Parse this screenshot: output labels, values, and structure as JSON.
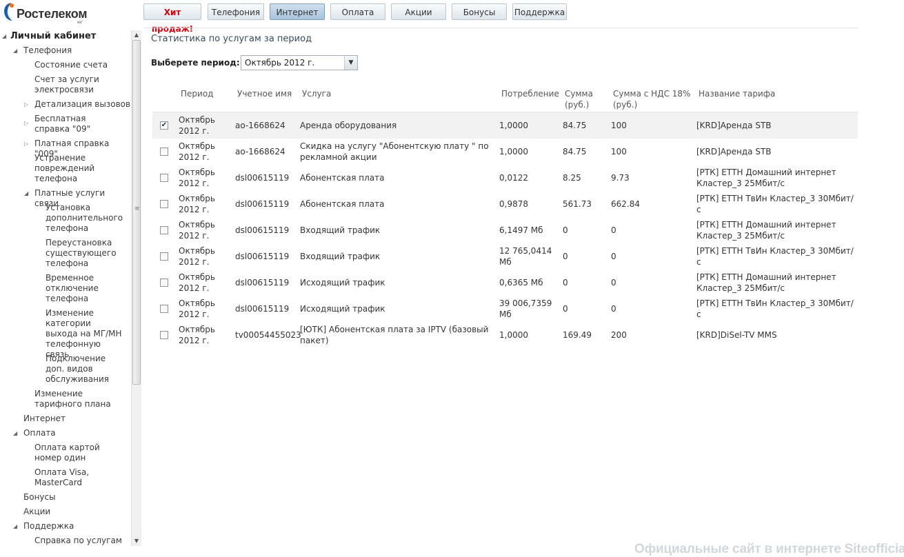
{
  "brand": {
    "name": "Ростелеком",
    "region": "юг"
  },
  "topnav": [
    {
      "label": "Хит продаж!"
    },
    {
      "label": "Телефония"
    },
    {
      "label": "Интернет"
    },
    {
      "label": "Оплата"
    },
    {
      "label": "Акции"
    },
    {
      "label": "Бонусы"
    },
    {
      "label": "Поддержка"
    }
  ],
  "sidebar": {
    "root": "Личный кабинет",
    "items": [
      {
        "label": "Телефония"
      },
      {
        "label": "Состояние счета"
      },
      {
        "label": "Счет за услуги электросвязи"
      },
      {
        "label": "Детализация вызовов"
      },
      {
        "label": "Бесплатная справка \"09\""
      },
      {
        "label": "Платная справка \"009\""
      },
      {
        "label": "Устранение повреждений телефона"
      },
      {
        "label": "Платные услуги связи"
      },
      {
        "label": "Установка дополнительного телефона"
      },
      {
        "label": "Переустановка существующего телефона"
      },
      {
        "label": "Временное отключение телефона"
      },
      {
        "label": "Изменение категории выхода на МГ/МН телефонную связь"
      },
      {
        "label": "Подключение доп. видов обслуживания"
      },
      {
        "label": "Изменение тарифного плана"
      },
      {
        "label": "Интернет"
      },
      {
        "label": "Оплата"
      },
      {
        "label": "Оплата картой номер один"
      },
      {
        "label": "Оплата Visa, MasterCard"
      },
      {
        "label": "Бонусы"
      },
      {
        "label": "Акции"
      },
      {
        "label": "Поддержка"
      },
      {
        "label": "Справка по услугам"
      }
    ]
  },
  "main": {
    "title": "Статистика по услугам за период",
    "period_label": "Выберете период:",
    "period_value": "Октябрь 2012 г.",
    "columns": [
      "Период",
      "Учетное имя",
      "Услуга",
      "Потребление",
      "Сумма (руб.)",
      "Сумма с НДС 18% (руб.)",
      "Название тарифа"
    ],
    "rows": [
      {
        "checked": true,
        "period": "Октябрь 2012 г.",
        "account": "ao-1668624",
        "service": "Аренда оборудования",
        "usage": "1,0000",
        "sum": "84.75",
        "sum_vat": "100",
        "tariff": "[KRD]Аренда STB"
      },
      {
        "checked": false,
        "period": "Октябрь 2012 г.",
        "account": "ao-1668624",
        "service": "Скидка на услугу \"Абонентскую плату \" по рекламной акции",
        "usage": "1,0000",
        "sum": "84.75",
        "sum_vat": "100",
        "tariff": "[KRD]Аренда STB"
      },
      {
        "checked": false,
        "period": "Октябрь 2012 г.",
        "account": "dsl00615119",
        "service": "Абонентская плата",
        "usage": "0,0122",
        "sum": "8.25",
        "sum_vat": "9.73",
        "tariff": "[РТК] ЕТТН Домашний интернет Кластер_3 25Мбит/с"
      },
      {
        "checked": false,
        "period": "Октябрь 2012 г.",
        "account": "dsl00615119",
        "service": "Абонентская плата",
        "usage": "0,9878",
        "sum": "561.73",
        "sum_vat": "662.84",
        "tariff": "[РТК] ЕТТН ТвИн Кластер_3 30Мбит/с"
      },
      {
        "checked": false,
        "period": "Октябрь 2012 г.",
        "account": "dsl00615119",
        "service": "Входящий трафик",
        "usage": "6,1497 Мб",
        "sum": "0",
        "sum_vat": "0",
        "tariff": "[РТК] ЕТТН Домашний интернет Кластер_3 25Мбит/с"
      },
      {
        "checked": false,
        "period": "Октябрь 2012 г.",
        "account": "dsl00615119",
        "service": "Входящий трафик",
        "usage": "12 765,0414 Мб",
        "sum": "0",
        "sum_vat": "0",
        "tariff": "[РТК] ЕТТН ТвИн Кластер_3 30Мбит/с"
      },
      {
        "checked": false,
        "period": "Октябрь 2012 г.",
        "account": "dsl00615119",
        "service": "Исходящий трафик",
        "usage": "0,6365 Мб",
        "sum": "0",
        "sum_vat": "0",
        "tariff": "[РТК] ЕТТН Домашний интернет Кластер_3 25Мбит/с"
      },
      {
        "checked": false,
        "period": "Октябрь 2012 г.",
        "account": "dsl00615119",
        "service": "Исходящий трафик",
        "usage": "39 006,7359 Мб",
        "sum": "0",
        "sum_vat": "0",
        "tariff": "[РТК] ЕТТН ТвИн Кластер_3 30Мбит/с"
      },
      {
        "checked": false,
        "period": "Октябрь 2012 г.",
        "account": "tv00054455023",
        "service": "[ЮТК] Абонентская плата за IPTV (базовый пакет)",
        "usage": "1,0000",
        "sum": "169.49",
        "sum_vat": "200",
        "tariff": "[KRD]DiSel-TV MMS"
      }
    ]
  },
  "watermark": "Официальные сайт в интернете Siteofficial.ru",
  "colors": {
    "brand_blue": "#1b5fa8",
    "hot_red": "#d8000b"
  }
}
